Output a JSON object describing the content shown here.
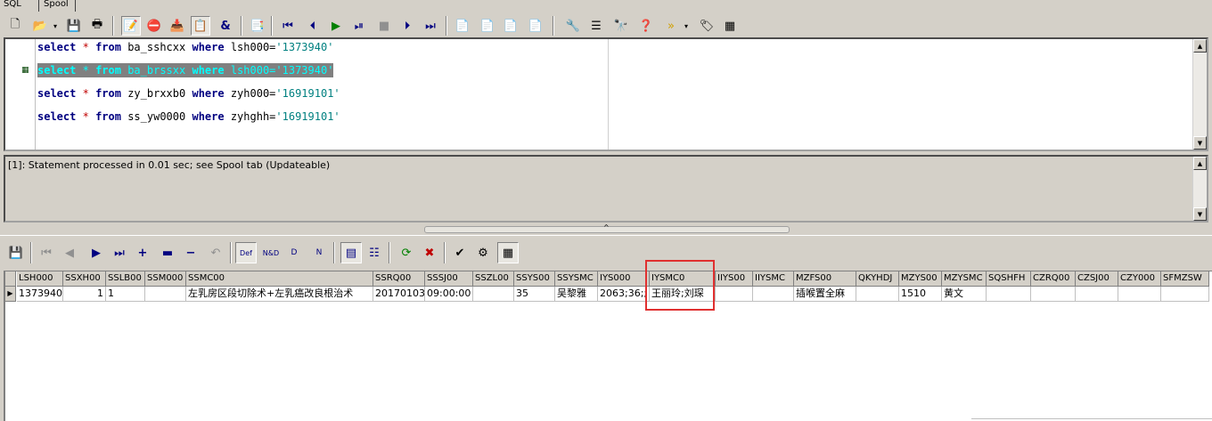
{
  "tabs": [
    {
      "label": "SQL"
    },
    {
      "label": "Spool"
    }
  ],
  "toolbar_icons": [
    "new-icon",
    "open-sql-icon",
    "dropdown-icon",
    "save-icon",
    "print-icon",
    "edit-icon",
    "explain-icon",
    "load-icon",
    "paste-icon",
    "ampersand-icon",
    "copy-icon",
    "first-icon",
    "prev-icon",
    "run-icon",
    "run-to-end-icon",
    "stop-icon",
    "step-icon",
    "last-icon",
    "doc1-icon",
    "doc2-icon",
    "doc3-icon",
    "doc4-icon",
    "wand-icon",
    "list-icon",
    "binoculars-icon",
    "help-icon",
    "forward-icon",
    "dropdown-icon",
    "tag-icon",
    "grid-icon"
  ],
  "editor": {
    "lines": [
      {
        "keyword1": "select",
        "op": "*",
        "keyword2": "from",
        "table": "ba_sshcxx",
        "keyword3": "where",
        "col": "lsh000=",
        "value": "'1373940'",
        "selected": false
      },
      {
        "keyword1": "select",
        "op": "*",
        "keyword2": "from",
        "table": "ba_brssxx",
        "keyword3": "where",
        "col": "lsh000=",
        "value": "'1373940'",
        "selected": true
      },
      {
        "keyword1": "select",
        "op": "*",
        "keyword2": "from",
        "table": "zy_brxxb0",
        "keyword3": "where",
        "col": "zyh000=",
        "value": "'16919101'",
        "selected": false
      },
      {
        "keyword1": "select",
        "op": "*",
        "keyword2": "from",
        "table": "ss_yw0000",
        "keyword3": "where",
        "col": "zyhghh=",
        "value": "'16919101'",
        "selected": false
      }
    ]
  },
  "message": {
    "text": "[1]: Statement processed in 0.01 sec; see Spool tab (Updateable)"
  },
  "grid": {
    "columns": [
      "LSH000",
      "SSXH00",
      "SSLB00",
      "SSM000",
      "SSMC00",
      "SSRQ00",
      "SSSJ00",
      "SSZL00",
      "SSYS00",
      "SSYSMC",
      "IYS000",
      "IYSMC0",
      "IIYS00",
      "IIYSMC",
      "MZFS00",
      "QKYHDJ",
      "MZYS00",
      "MZYSMC",
      "SQSHFH",
      "CZRQ00",
      "CZSJ00",
      "CZY000",
      "SFMZSW"
    ],
    "rows": [
      [
        "1373940",
        "1",
        "1",
        "",
        "左乳房区段切除术+左乳癌改良根治术",
        "20170103",
        "09:00:00",
        "",
        "35",
        "吴黎雅",
        "2063;36;;",
        "王丽玲;刘琛",
        "",
        "",
        "插喉置全麻",
        "",
        "1510",
        "黄文",
        "",
        "",
        "",
        "",
        ""
      ]
    ]
  },
  "colors": {
    "highlight_box": "#e03030",
    "keyword": "#000080",
    "string": "#008080",
    "selection": "#808080"
  }
}
